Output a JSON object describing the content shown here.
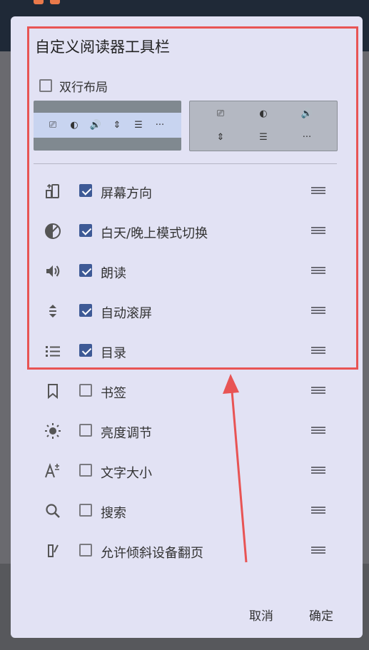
{
  "dialog": {
    "title": "自定义阅读器工具栏",
    "two_line_label": "双行布局",
    "two_line_checked": false,
    "items": [
      {
        "label": "屏幕方向",
        "icon": "screen-rotation-icon",
        "checked": true
      },
      {
        "label": "白天/晚上模式切换",
        "icon": "day-night-icon",
        "checked": true
      },
      {
        "label": "朗读",
        "icon": "speaker-icon",
        "checked": true
      },
      {
        "label": "自动滚屏",
        "icon": "auto-scroll-icon",
        "checked": true
      },
      {
        "label": "目录",
        "icon": "toc-list-icon",
        "checked": true
      },
      {
        "label": "书签",
        "icon": "bookmark-icon",
        "checked": false
      },
      {
        "label": "亮度调节",
        "icon": "brightness-icon",
        "checked": false
      },
      {
        "label": "文字大小",
        "icon": "font-size-icon",
        "checked": false
      },
      {
        "label": "搜索",
        "icon": "search-icon",
        "checked": false
      },
      {
        "label": "允许倾斜设备翻页",
        "icon": "tilt-pen-icon",
        "checked": false
      }
    ],
    "cancel_label": "取消",
    "ok_label": "确定"
  },
  "preview": {
    "single_line_glyphs": [
      "⎚",
      "◐",
      "🔊",
      "⇕",
      "☰",
      "···"
    ],
    "double_line_glyphs": [
      "⎚",
      "◐",
      "🔊",
      "⇕",
      "☰",
      "···"
    ]
  },
  "colors": {
    "accent": "#3e5a96",
    "highlight": "#e85454",
    "dialog_bg": "#e2e2f4"
  }
}
